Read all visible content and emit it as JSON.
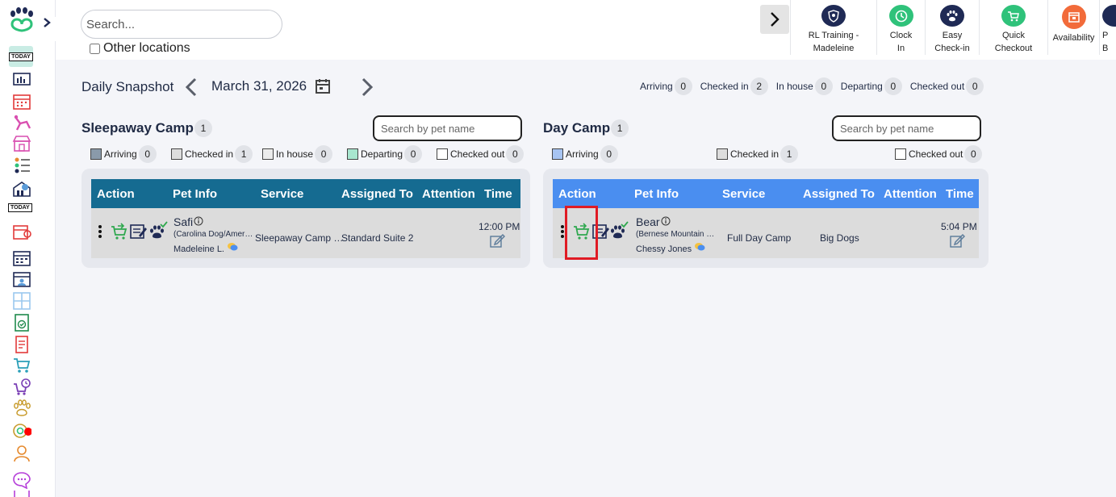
{
  "search": {
    "placeholder": "Search..."
  },
  "other_locations": {
    "label": "Other locations",
    "checked": false
  },
  "rail": {
    "today_label": "TODAY",
    "today2_label": "TODAY"
  },
  "quick_actions": [
    {
      "label": "RL Training - Madeleine",
      "color": "#1f2a55",
      "icon": "shield-icon"
    },
    {
      "label": "Clock In",
      "color": "#2fc27a",
      "icon": "clock-icon"
    },
    {
      "label": "Easy Check-in",
      "color": "#1f2a55",
      "icon": "paw-icon"
    },
    {
      "label": "Quick Checkout",
      "color": "#2fc27a",
      "icon": "cart-icon"
    },
    {
      "label": "Availability",
      "color": "#f26b3a",
      "icon": "calendar-icon"
    },
    {
      "label": "P B",
      "color": "#1f2a55",
      "icon": "partial-icon"
    }
  ],
  "snapshot": {
    "title": "Daily Snapshot",
    "date": "March 31, 2026",
    "totals": [
      {
        "label": "Arriving",
        "count": "0"
      },
      {
        "label": "Checked in",
        "count": "2"
      },
      {
        "label": "In house",
        "count": "0"
      },
      {
        "label": "Departing",
        "count": "0"
      },
      {
        "label": "Checked out",
        "count": "0"
      }
    ]
  },
  "sleepaway": {
    "title": "Sleepaway Camp",
    "count": "1",
    "search_placeholder": "Search by pet name",
    "legend": [
      {
        "label": "Arriving",
        "count": "0",
        "color": "#8a9aaa"
      },
      {
        "label": "Checked in",
        "count": "1",
        "color": "#dddddd"
      },
      {
        "label": "In house",
        "count": "0",
        "color": "#ececec"
      },
      {
        "label": "Departing",
        "count": "0",
        "color": "#a8e6cf"
      },
      {
        "label": "Checked out",
        "count": "0",
        "color": "#ffffff"
      }
    ],
    "header_color": "#156b91",
    "columns": [
      "Action",
      "Pet Info",
      "Service",
      "Assigned To",
      "Attention",
      "Time"
    ],
    "row": {
      "pet_name": "Safi",
      "breed": "(Carolina Dog/Amer…",
      "owner": "Madeleine L.",
      "service": "Sleepaway Camp …",
      "assigned": "Standard Suite 2",
      "time": "12:00 PM"
    }
  },
  "daycamp": {
    "title": "Day Camp",
    "count": "1",
    "search_placeholder": "Search by pet name",
    "legend": [
      {
        "label": "Arriving",
        "count": "0",
        "color": "#a7c4f2"
      },
      {
        "label": "Checked in",
        "count": "1",
        "color": "#dddddd"
      },
      {
        "label": "Checked out",
        "count": "0",
        "color": "#ffffff"
      }
    ],
    "header_color": "#4a8ef0",
    "columns": [
      "Action",
      "Pet Info",
      "Service",
      "Assigned To",
      "Attention",
      "Time"
    ],
    "row": {
      "pet_name": "Bear",
      "breed": "(Bernese Mountain …",
      "owner": "Chessy Jones",
      "service": "Full Day Camp",
      "assigned": "Big Dogs",
      "time": "5:04 PM"
    }
  }
}
